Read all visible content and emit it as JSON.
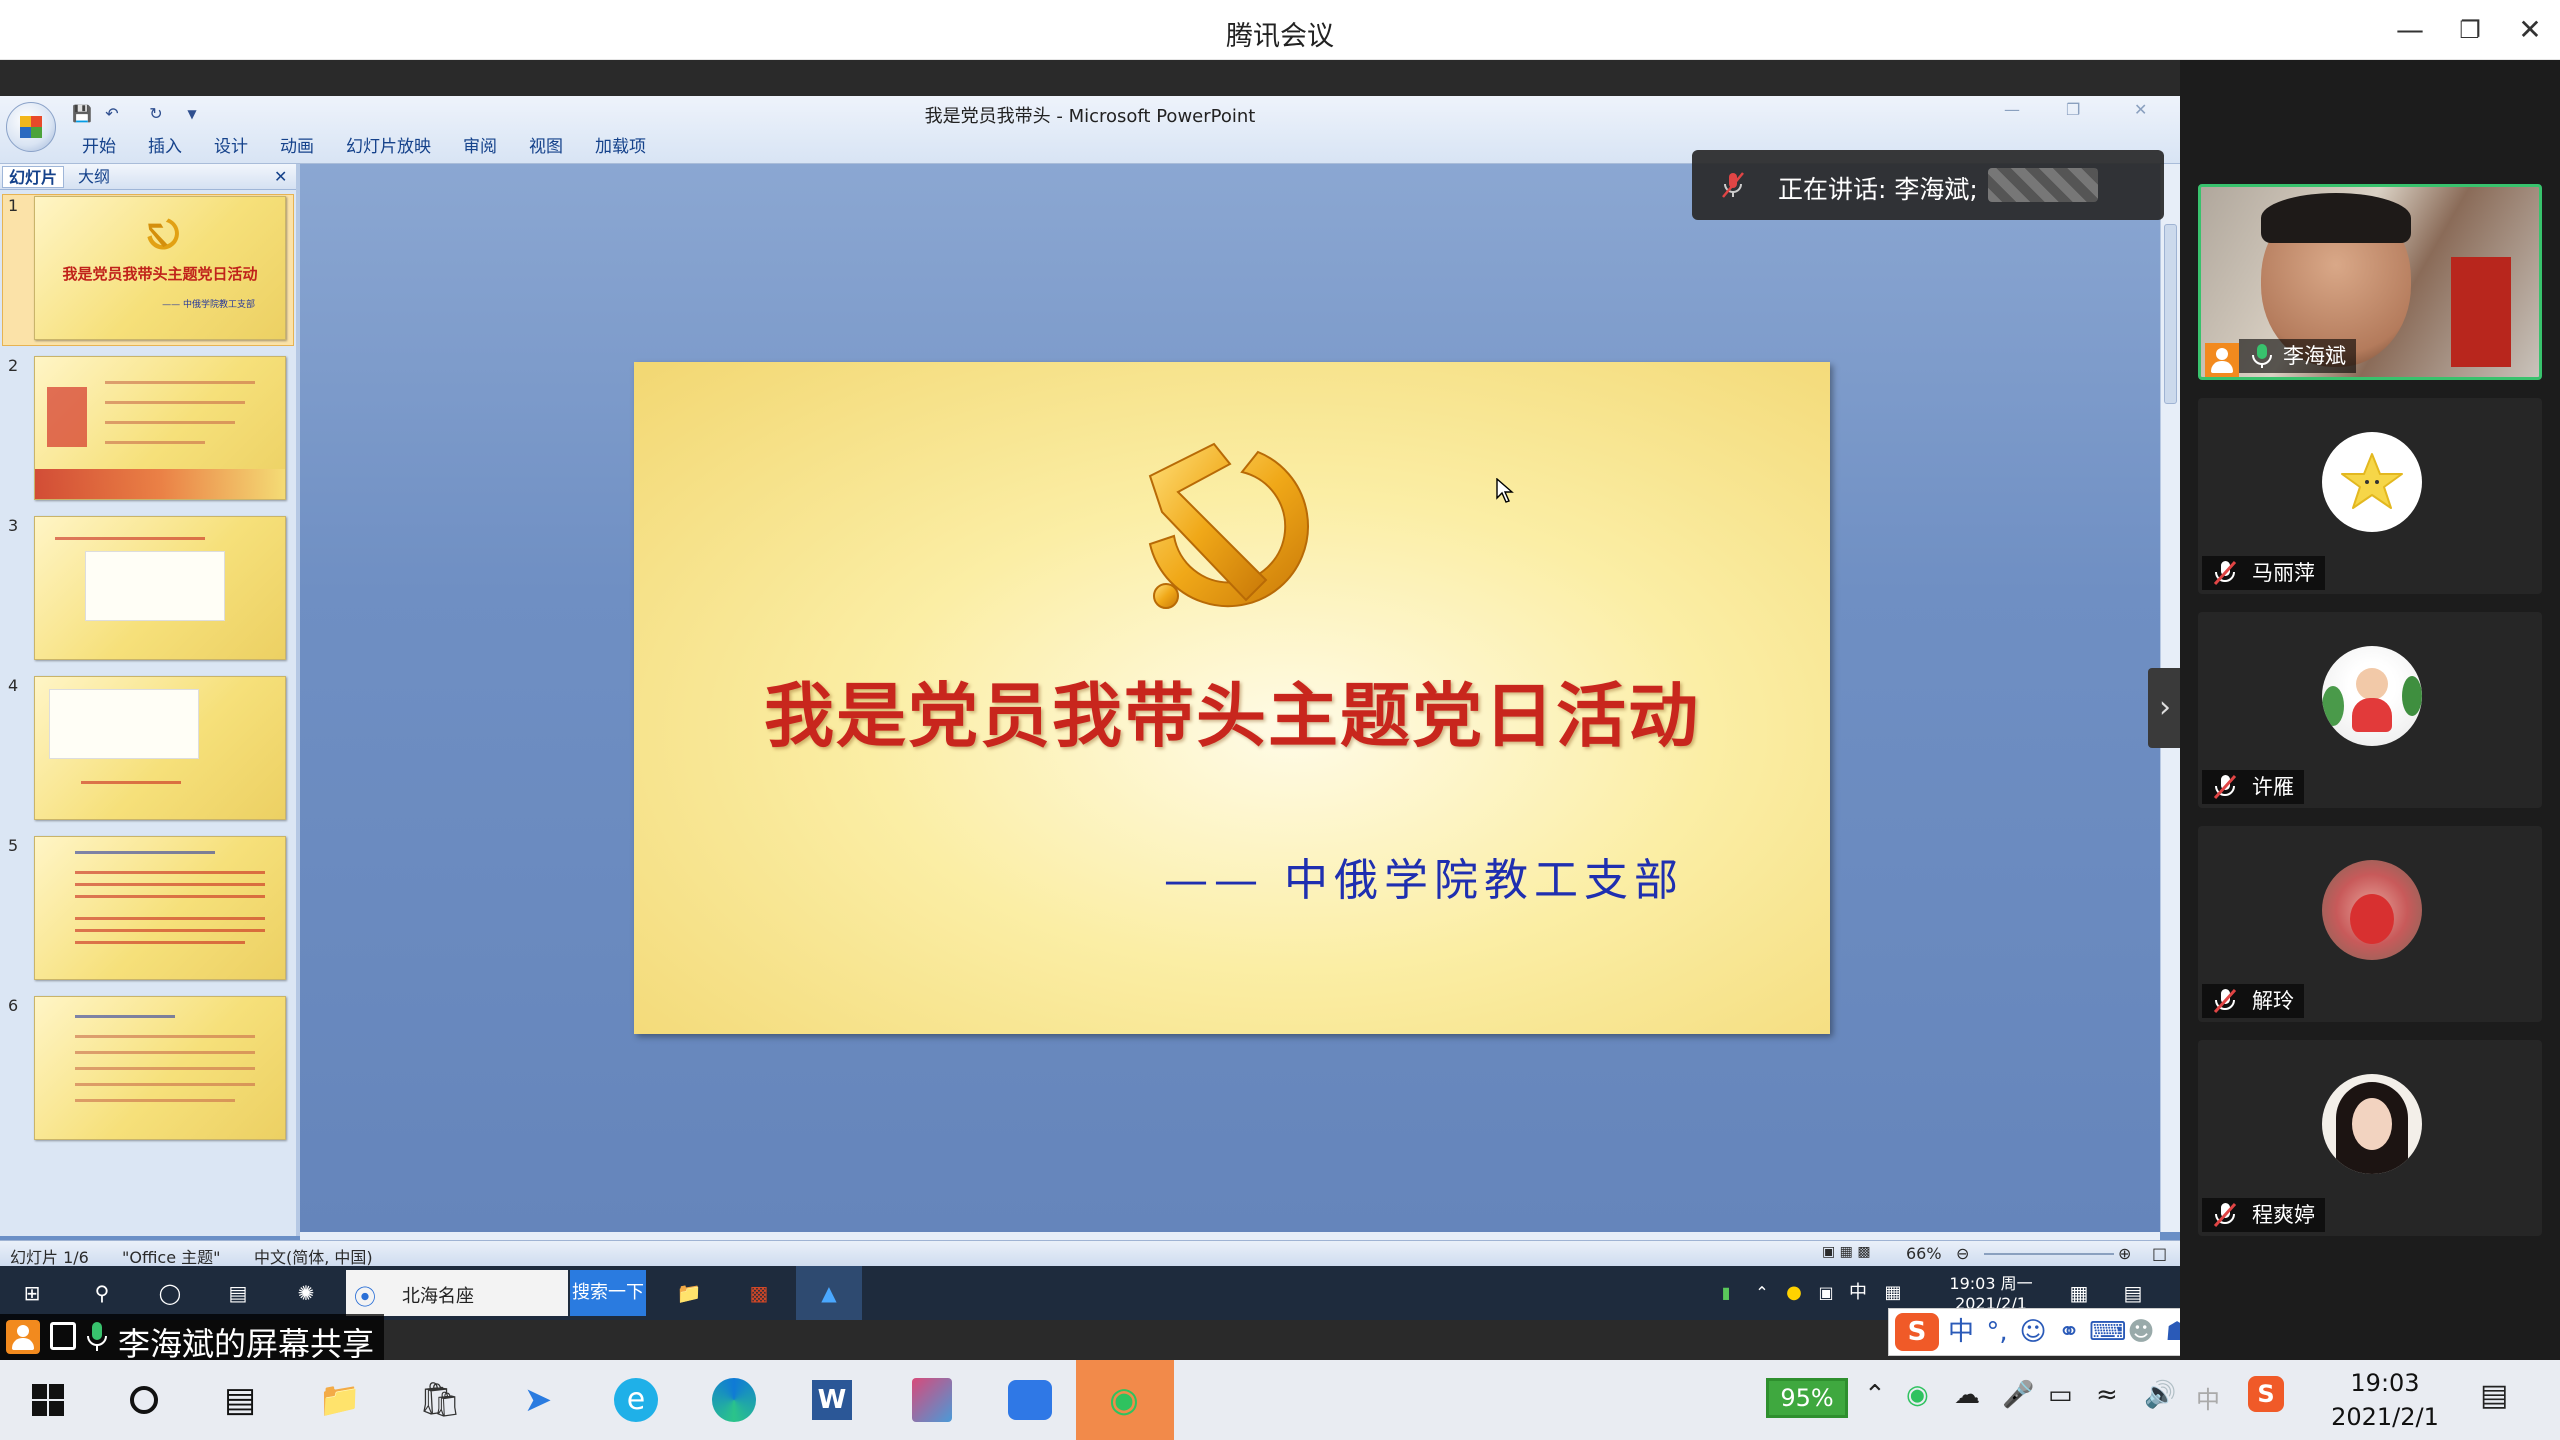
{
  "meeting": {
    "title": "腾讯会议"
  },
  "ppt": {
    "window_title": "我是党员我带头 - Microsoft PowerPoint",
    "ribbon_tabs": [
      "开始",
      "插入",
      "设计",
      "动画",
      "幻灯片放映",
      "审阅",
      "视图",
      "加载项"
    ],
    "pane_tabs": [
      "幻灯片",
      "大纲"
    ],
    "slide_numbers": [
      "1",
      "2",
      "3",
      "4",
      "5",
      "6"
    ],
    "thumb1_title": "我是党员我带头主题党日活动",
    "thumb1_sub": "—— 中俄学院教工支部",
    "slide": {
      "title": "我是党员我带头主题党日活动",
      "subtitle": "—— 中俄学院教工支部"
    },
    "status": {
      "slide_pos": "幻灯片 1/6",
      "theme": "\"Office 主题\"",
      "lang": "中文(简体, 中国)",
      "zoom": "66%"
    }
  },
  "speaking": {
    "label": "正在讲话: 李海斌;"
  },
  "share_label": "李海斌的屏幕共享",
  "inner_taskbar": {
    "search_text": "北海名座",
    "search_button": "搜索一下",
    "time": "19:03 周一",
    "date": "2021/2/1",
    "ime_lang": "中"
  },
  "participants": [
    {
      "name": "李海斌",
      "muted": false,
      "video": true
    },
    {
      "name": "马丽萍",
      "muted": true,
      "video": false
    },
    {
      "name": "许雁",
      "muted": true,
      "video": false
    },
    {
      "name": "解玲",
      "muted": true,
      "video": false
    },
    {
      "name": "程爽婷",
      "muted": true,
      "video": false
    }
  ],
  "taskbar": {
    "battery": "95%",
    "ime": "中",
    "time": "19:03",
    "date": "2021/2/1"
  },
  "icons": [
    "windows-start-icon",
    "search-circle-icon",
    "task-view-icon",
    "file-explorer-icon",
    "store-icon",
    "feishu-icon",
    "browser-icon",
    "edge-icon",
    "word-icon",
    "reader-icon",
    "tencent-meeting-icon",
    "wechat-icon"
  ],
  "colors": {
    "title_red": "#c8261d",
    "subtitle_blue": "#1f2fb0",
    "speaking_green": "#38c26d"
  }
}
